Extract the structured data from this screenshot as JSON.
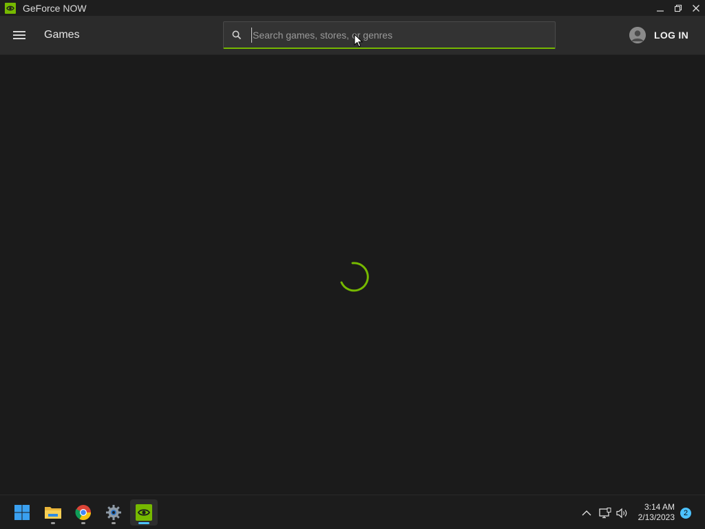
{
  "window": {
    "title": "GeForce NOW",
    "controls": [
      "minimize",
      "restore",
      "close"
    ]
  },
  "header": {
    "page_title": "Games",
    "search": {
      "value": "",
      "placeholder": "Search games, stores, or genres"
    },
    "login_label": "LOG IN"
  },
  "content": {
    "state": "loading"
  },
  "colors": {
    "accent": "#76b900",
    "background": "#1b1b1b",
    "header": "#2b2b2b",
    "taskbar_indicator": "#4cc2ff"
  },
  "taskbar": {
    "apps": [
      {
        "icon": "windows-start-icon",
        "running": false,
        "active": false
      },
      {
        "icon": "file-explorer-icon",
        "running": true,
        "active": false
      },
      {
        "icon": "chrome-icon",
        "running": true,
        "active": false
      },
      {
        "icon": "settings-icon",
        "running": true,
        "active": false
      },
      {
        "icon": "geforce-now-icon",
        "running": true,
        "active": true
      }
    ],
    "tray": {
      "icons": [
        "chevron-up-icon",
        "network-icon",
        "volume-icon"
      ],
      "time": "3:14 AM",
      "date": "2/13/2023",
      "notification_count": "2"
    }
  }
}
